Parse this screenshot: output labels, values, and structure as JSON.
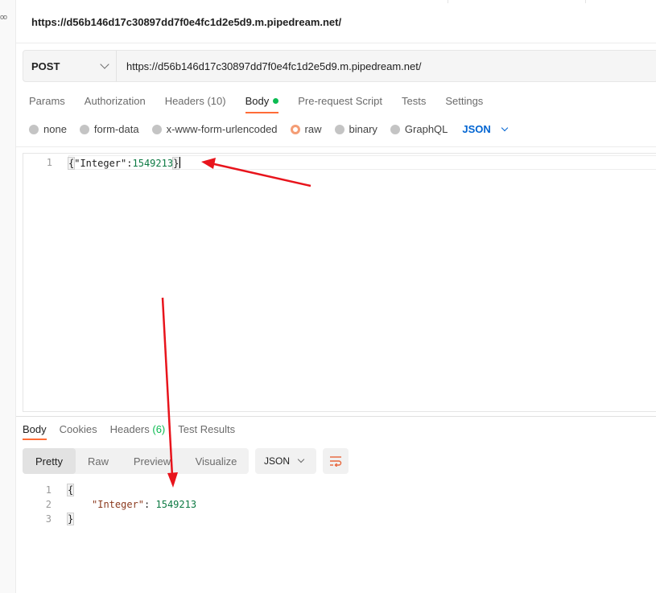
{
  "left_rail": {
    "glyph": "oo"
  },
  "request": {
    "title": "https://d56b146d17c30897dd7f0e4fc1d2e5d9.m.pipedream.net/",
    "method": "POST",
    "url": "https://d56b146d17c30897dd7f0e4fc1d2e5d9.m.pipedream.net/"
  },
  "request_tabs": [
    {
      "label": "Params"
    },
    {
      "label": "Authorization"
    },
    {
      "label": "Headers",
      "count": "(10)"
    },
    {
      "label": "Body",
      "active": true
    },
    {
      "label": "Pre-request Script"
    },
    {
      "label": "Tests"
    },
    {
      "label": "Settings"
    }
  ],
  "body_modes": {
    "options": [
      "none",
      "form-data",
      "x-www-form-urlencoded",
      "raw",
      "binary",
      "GraphQL"
    ],
    "selected": "raw",
    "language": "JSON"
  },
  "request_body": {
    "line_number": "1",
    "open_brace": "{",
    "key": "\"Integer\"",
    "colon": ":",
    "value": "1549213",
    "close_brace": "}"
  },
  "response_tabs": [
    {
      "label": "Body",
      "active": true
    },
    {
      "label": "Cookies"
    },
    {
      "label": "Headers",
      "count": "(6)"
    },
    {
      "label": "Test Results"
    }
  ],
  "response_view": {
    "modes": [
      "Pretty",
      "Raw",
      "Preview",
      "Visualize"
    ],
    "selected": "Pretty",
    "format": "JSON"
  },
  "response_body": {
    "line_numbers": [
      "1",
      "2",
      "3"
    ],
    "open_brace": "{",
    "key": "\"Integer\"",
    "colon": ":",
    "value": "1549213",
    "close_brace": "}"
  },
  "colors": {
    "accent_orange": "#ff6c37",
    "link_blue": "#0265d2",
    "success_green": "#0cbb52",
    "annotation_red": "#e8141c"
  },
  "annotations": {
    "arrows": [
      "arrow-to-request-body",
      "arrow-to-response-body"
    ]
  }
}
